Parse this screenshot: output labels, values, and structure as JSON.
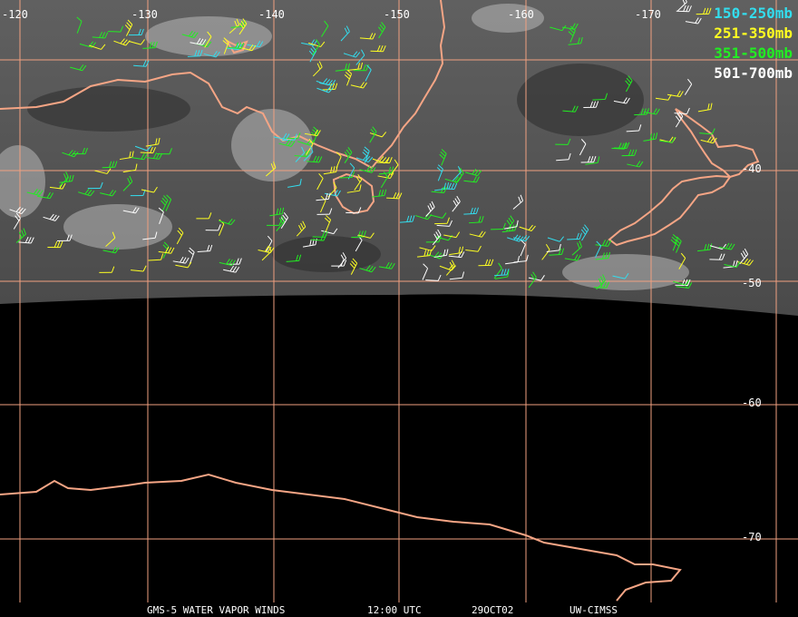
{
  "map": {
    "lon_labels": [
      "-120",
      "-130",
      "-140",
      "-150",
      "-160",
      "-170"
    ],
    "lat_labels": [
      "-40",
      "-50",
      "-60",
      "-70"
    ],
    "legend": [
      {
        "label": "150-250mb",
        "color": "#33ddee"
      },
      {
        "label": "251-350mb",
        "color": "#ffff22"
      },
      {
        "label": "351-500mb",
        "color": "#22ee22"
      },
      {
        "label": "501-700mb",
        "color": "#ffffff"
      }
    ],
    "colors": {
      "grid": "#f0a080",
      "coast": "#f5a585",
      "background": "#000000",
      "vapor": "#505050"
    },
    "footer": {
      "product": "GMS-5 WATER VAPOR WINDS",
      "time": "12:00 UTC",
      "date": "29OCT02",
      "source": "UW-CIMSS"
    }
  }
}
